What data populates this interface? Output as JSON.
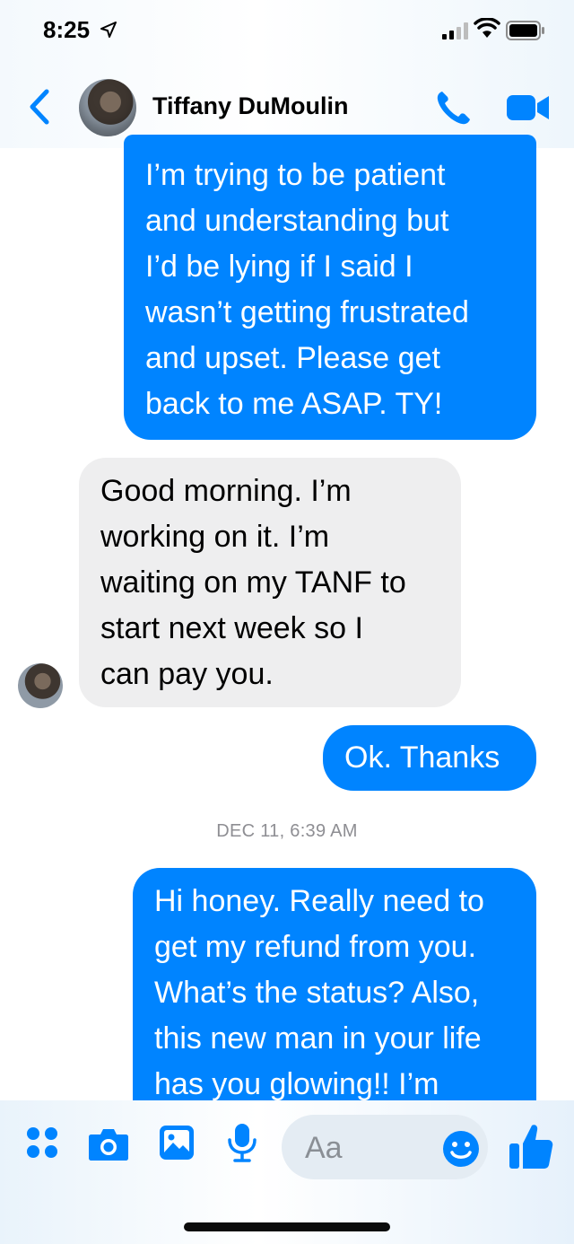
{
  "status_bar": {
    "time": "8:25"
  },
  "header": {
    "contact_name": "Tiffany DuMoulin"
  },
  "messages": [
    {
      "direction": "outgoing",
      "text": "I’m trying to be patient\nand understanding but\nI’d be lying if I said I\nwasn’t getting frustrated\nand upset. Please get\nback to me ASAP. TY!"
    },
    {
      "direction": "incoming",
      "text": "Good morning. I’m\nworking on it. I’m\nwaiting on my TANF to\nstart next week so I\ncan pay you."
    },
    {
      "direction": "outgoing",
      "text": "Ok. Thanks"
    },
    {
      "direction": "outgoing",
      "text": "Hi honey. Really need to\nget my refund from you.\nWhat’s the status? Also,\nthis new man in your life\nhas you glowing!! I’m"
    }
  ],
  "timestamp": "DEC 11, 6:39 AM",
  "composer": {
    "placeholder": "Aa"
  },
  "colors": {
    "accent": "#0084ff",
    "incoming_bubble": "#eeeeef",
    "timestamp": "#8e8e93"
  },
  "icons": [
    "location-arrow-icon",
    "signal-icon",
    "wifi-icon",
    "battery-icon",
    "back-chevron-icon",
    "phone-icon",
    "video-camera-icon",
    "more-grid-icon",
    "camera-icon",
    "photo-icon",
    "microphone-icon",
    "emoji-icon",
    "thumbs-up-icon"
  ]
}
